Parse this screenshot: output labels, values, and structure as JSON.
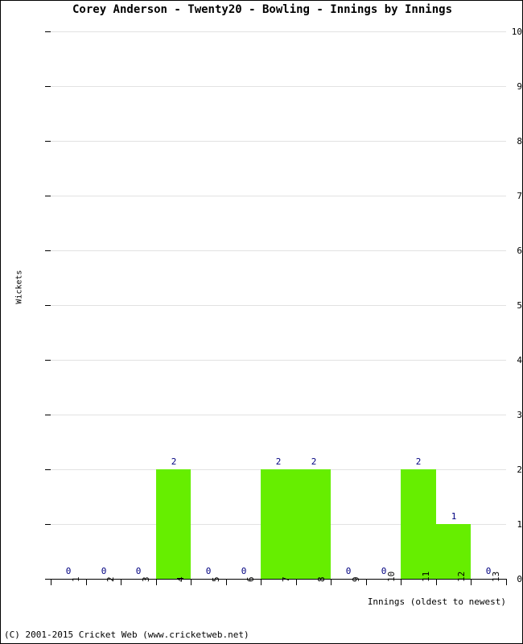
{
  "chart_data": {
    "type": "bar",
    "title": "Corey Anderson - Twenty20 - Bowling - Innings by Innings",
    "xlabel": "Innings (oldest to newest)",
    "ylabel": "Wickets",
    "categories": [
      "1",
      "2",
      "3",
      "4",
      "5",
      "6",
      "7",
      "8",
      "9",
      "10",
      "11",
      "12",
      "13"
    ],
    "values": [
      0,
      0,
      0,
      2,
      0,
      0,
      2,
      2,
      0,
      0,
      2,
      1,
      0
    ],
    "value_labels": [
      "0",
      "0",
      "0",
      "2",
      "0",
      "0",
      "2",
      "2",
      "0",
      "0",
      "2",
      "1",
      "0"
    ],
    "ylim": [
      0,
      10
    ],
    "yticks": [
      0,
      1,
      2,
      3,
      4,
      5,
      6,
      7,
      8,
      9,
      10
    ],
    "ytick_labels": [
      "0",
      "1",
      "2",
      "3",
      "4",
      "5",
      "6",
      "7",
      "8",
      "9",
      "10"
    ],
    "grid": true,
    "legend": null,
    "bar_color": "#66EE00",
    "value_label_color": "#000080",
    "grid_color": "#E2E2E2",
    "axis_color": "#000000"
  },
  "footer": {
    "copyright": "(C) 2001-2015 Cricket Web (www.cricketweb.net)"
  }
}
